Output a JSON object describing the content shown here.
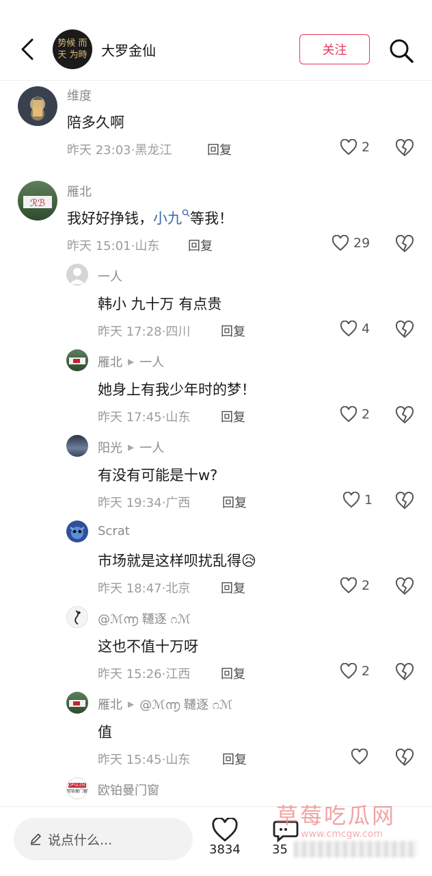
{
  "header": {
    "author_name": "大罗金仙",
    "avatar_text": "势候 而天 为時",
    "follow_label": "关注",
    "back_icon": "chevron-left-icon",
    "search_icon": "search-icon"
  },
  "comments": [
    {
      "user": "维度",
      "text": "陪多久啊",
      "time": "昨天 23:03·黑龙江",
      "reply": "回复",
      "likes": "2",
      "level": "top"
    },
    {
      "user": "雁北",
      "text_before": "我好好挣钱，",
      "mention": "小九",
      "text_after": "等我！",
      "time": "昨天 15:01·山东",
      "reply": "回复",
      "likes": "29",
      "level": "top"
    },
    {
      "user": "一人",
      "text": "韩小  九十万  有点贵",
      "time": "昨天 17:28·四川",
      "reply": "回复",
      "likes": "4",
      "level": "reply"
    },
    {
      "user": "雁北",
      "to": "一人",
      "text": "她身上有我少年时的梦！",
      "time": "昨天 17:45·山东",
      "reply": "回复",
      "likes": "2",
      "level": "reply"
    },
    {
      "user": "阳光",
      "to": "一人",
      "text": "有没有可能是十w?",
      "time": "昨天 19:34·广西",
      "reply": "回复",
      "likes": "1",
      "level": "reply"
    },
    {
      "user": "Scrat",
      "text": "市场就是这样呗扰乱得",
      "emoji": "😥",
      "time": "昨天 18:47·北京",
      "reply": "回复",
      "likes": "2",
      "level": "reply"
    },
    {
      "user": "@ℳ൬ 韆逐 ೧ℳ",
      "text": "这也不值十万呀",
      "time": "昨天 15:26·江西",
      "reply": "回复",
      "likes": "2",
      "level": "reply"
    },
    {
      "user": "雁北",
      "to": "@ℳ൬ 韆逐 ೧ℳ",
      "text": "值",
      "time": "昨天 15:45·山东",
      "reply": "回复",
      "likes": "",
      "level": "reply"
    },
    {
      "user": "欧铂曼门窗",
      "level": "reply"
    }
  ],
  "avatar_labels": {
    "opulent": "欧铂曼门窗"
  },
  "bottom": {
    "input_placeholder": "说点什么...",
    "like_count": "3834",
    "comment_count": "35"
  },
  "watermark": {
    "title": "草莓吃瓜网",
    "url": "www.cmcgw.com"
  },
  "colors": {
    "accent": "#e8365b",
    "mention": "#3c68a8",
    "meta": "#9c9c9c"
  }
}
